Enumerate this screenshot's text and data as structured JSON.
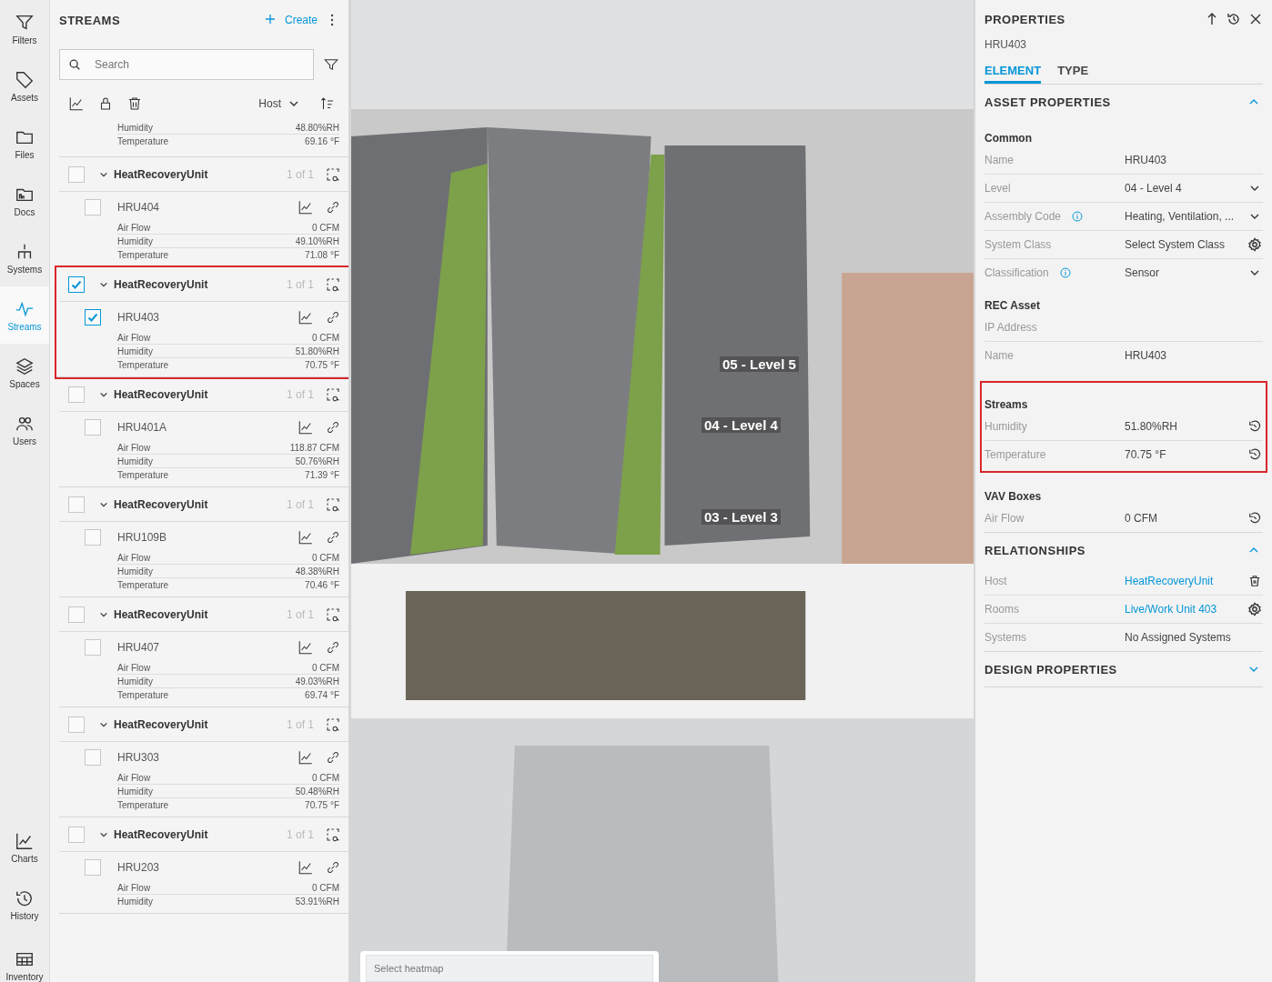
{
  "nav": {
    "top": [
      {
        "label": "Filters",
        "selected": false
      },
      {
        "label": "Assets",
        "selected": false
      },
      {
        "label": "Files",
        "selected": false
      },
      {
        "label": "Docs",
        "selected": false
      },
      {
        "label": "Systems",
        "selected": false
      },
      {
        "label": "Streams",
        "selected": true
      },
      {
        "label": "Spaces",
        "selected": false
      },
      {
        "label": "Users",
        "selected": false
      }
    ],
    "bottom": [
      {
        "label": "Charts",
        "selected": false
      },
      {
        "label": "History",
        "selected": false
      },
      {
        "label": "Inventory",
        "selected": false
      }
    ]
  },
  "streams": {
    "title": "STREAMS",
    "create": "Create",
    "search": {
      "placeholder": "Search"
    },
    "group_by": "Host",
    "partial_readings": [
      {
        "label": "Humidity",
        "value": "48.80%RH"
      },
      {
        "label": "Temperature",
        "value": "69.16 °F"
      }
    ],
    "groups": [
      {
        "host": "HeatRecoveryUnit",
        "count": "1 of 1",
        "checked": false,
        "highlighted": false,
        "item": {
          "name": "HRU404",
          "checked": false,
          "readings": [
            {
              "label": "Air Flow",
              "value": "0 CFM"
            },
            {
              "label": "Humidity",
              "value": "49.10%RH"
            },
            {
              "label": "Temperature",
              "value": "71.08 °F"
            }
          ]
        }
      },
      {
        "host": "HeatRecoveryUnit",
        "count": "1 of 1",
        "checked": true,
        "highlighted": true,
        "item": {
          "name": "HRU403",
          "checked": true,
          "readings": [
            {
              "label": "Air Flow",
              "value": "0 CFM"
            },
            {
              "label": "Humidity",
              "value": "51.80%RH"
            },
            {
              "label": "Temperature",
              "value": "70.75 °F"
            }
          ]
        }
      },
      {
        "host": "HeatRecoveryUnit",
        "count": "1 of 1",
        "checked": false,
        "highlighted": false,
        "item": {
          "name": "HRU401A",
          "checked": false,
          "readings": [
            {
              "label": "Air Flow",
              "value": "118.87 CFM"
            },
            {
              "label": "Humidity",
              "value": "50.76%RH"
            },
            {
              "label": "Temperature",
              "value": "71.39 °F"
            }
          ]
        }
      },
      {
        "host": "HeatRecoveryUnit",
        "count": "1 of 1",
        "checked": false,
        "highlighted": false,
        "item": {
          "name": "HRU109B",
          "checked": false,
          "readings": [
            {
              "label": "Air Flow",
              "value": "0 CFM"
            },
            {
              "label": "Humidity",
              "value": "48.38%RH"
            },
            {
              "label": "Temperature",
              "value": "70.46 °F"
            }
          ]
        }
      },
      {
        "host": "HeatRecoveryUnit",
        "count": "1 of 1",
        "checked": false,
        "highlighted": false,
        "item": {
          "name": "HRU407",
          "checked": false,
          "readings": [
            {
              "label": "Air Flow",
              "value": "0 CFM"
            },
            {
              "label": "Humidity",
              "value": "49.03%RH"
            },
            {
              "label": "Temperature",
              "value": "69.74 °F"
            }
          ]
        }
      },
      {
        "host": "HeatRecoveryUnit",
        "count": "1 of 1",
        "checked": false,
        "highlighted": false,
        "item": {
          "name": "HRU303",
          "checked": false,
          "readings": [
            {
              "label": "Air Flow",
              "value": "0 CFM"
            },
            {
              "label": "Humidity",
              "value": "50.48%RH"
            },
            {
              "label": "Temperature",
              "value": "70.75 °F"
            }
          ]
        }
      },
      {
        "host": "HeatRecoveryUnit",
        "count": "1 of 1",
        "checked": false,
        "highlighted": false,
        "item": {
          "name": "HRU203",
          "checked": false,
          "readings": [
            {
              "label": "Air Flow",
              "value": "0 CFM"
            },
            {
              "label": "Humidity",
              "value": "53.91%RH"
            }
          ]
        }
      }
    ]
  },
  "viewport": {
    "level_labels": [
      "05 - Level 5",
      "04 - Level 4",
      "03 - Level 3"
    ],
    "heatmap": {
      "placeholder": "Select heatmap"
    }
  },
  "properties": {
    "title": "PROPERTIES",
    "subtitle": "HRU403",
    "tabs": [
      {
        "label": "ELEMENT",
        "selected": true
      },
      {
        "label": "TYPE",
        "selected": false
      }
    ],
    "sections": [
      {
        "title": "ASSET PROPERTIES",
        "expanded": true,
        "groups": [
          {
            "title": "Common",
            "highlighted": false,
            "rows": [
              {
                "label": "Name",
                "value": "HRU403"
              },
              {
                "label": "Level",
                "value": "04 - Level 4",
                "kind": "dropdown"
              },
              {
                "label": "Assembly Code",
                "info": true,
                "value": "Heating, Ventilation, ...",
                "kind": "dropdown"
              },
              {
                "label": "System Class",
                "value": "Select System Class",
                "kind": "gear"
              },
              {
                "label": "Classification",
                "info": true,
                "value": "Sensor",
                "kind": "dropdown"
              }
            ]
          },
          {
            "title": "REC Asset",
            "highlighted": false,
            "rows": [
              {
                "label": "IP Address"
              },
              {
                "label": "Name",
                "value": "HRU403"
              }
            ]
          },
          {
            "title": "Streams",
            "highlighted": true,
            "rows": [
              {
                "label": "Humidity",
                "value": "51.80%RH",
                "kind": "reset"
              },
              {
                "label": "Temperature",
                "value": "70.75 °F",
                "kind": "reset"
              }
            ]
          },
          {
            "title": "VAV Boxes",
            "highlighted": false,
            "rows": [
              {
                "label": "Air Flow",
                "value": "0 CFM",
                "kind": "reset"
              }
            ]
          }
        ]
      },
      {
        "title": "RELATIONSHIPS",
        "expanded": true,
        "groups": [
          {
            "rows": [
              {
                "label": "Host",
                "value": "HeatRecoveryUnit",
                "link": true,
                "kind": "trash"
              },
              {
                "label": "Rooms",
                "value": "Live/Work Unit 403",
                "link": true,
                "kind": "gear"
              },
              {
                "label": "Systems",
                "value": "No Assigned Systems"
              }
            ]
          }
        ]
      },
      {
        "title": "DESIGN PROPERTIES",
        "expanded": false
      }
    ]
  }
}
